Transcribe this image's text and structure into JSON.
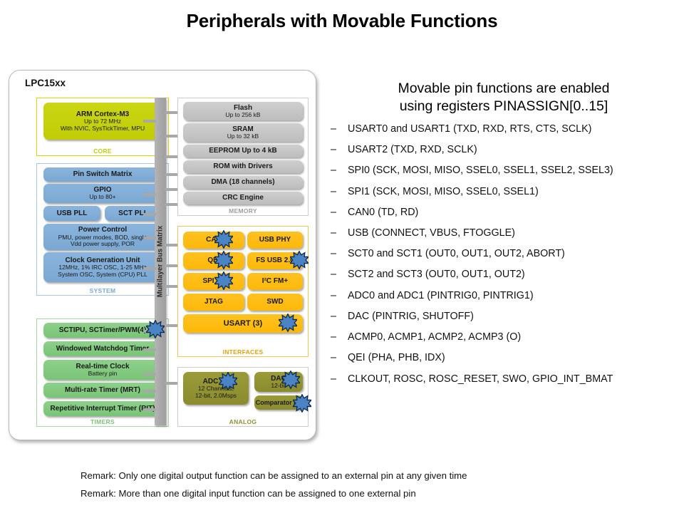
{
  "slide": {
    "title": "Peripherals with Movable Functions"
  },
  "chip": {
    "name": "LPC15xx",
    "bus_matrix_label": "Multilayer Bus Matrix",
    "groups": {
      "core": {
        "label": "CORE",
        "blocks": [
          {
            "title": "ARM Cortex-M3",
            "line2": "Up to 72 MHz",
            "line3": "With NVIC, SysTickTimer, MPU",
            "burst": false
          }
        ]
      },
      "system": {
        "label": "SYSTEM",
        "blocks": [
          {
            "title": "Pin Switch Matrix",
            "line2": "",
            "burst": false
          },
          {
            "title": "GPIO",
            "line2": "Up to 80+",
            "burst": false
          },
          {
            "title": "USB PLL",
            "line2": "",
            "burst": false
          },
          {
            "title": "SCT PLL",
            "line2": "",
            "burst": false
          },
          {
            "title": "Power Control",
            "line2": "PMU, power modes, BOD, single",
            "line3": "Vdd power supply, POR",
            "burst": false
          },
          {
            "title": "Clock Generation  Unit",
            "line2": "12MHz, 1% IRC OSC, 1-25 MHz",
            "line3": "System OSC, System (CPU) PLL",
            "burst": false
          }
        ]
      },
      "timers": {
        "label": "TIMERS",
        "blocks": [
          {
            "title": "SCTIPU, SCTimer/PWM(4)",
            "line2": "",
            "burst": true
          },
          {
            "title": "Windowed  Watchdog Timer",
            "line2": "",
            "burst": false
          },
          {
            "title": "Real-time Clock",
            "line2": "Battery pin",
            "burst": false
          },
          {
            "title": "Multi-rate Timer (MRT)",
            "line2": "",
            "burst": false
          },
          {
            "title": "Repetitive Interrupt  Timer (RIT)",
            "line2": "",
            "burst": false
          }
        ]
      },
      "memory": {
        "label": "MEMORY",
        "blocks": [
          {
            "title": "Flash",
            "line2": "Up to 256 kB",
            "burst": false
          },
          {
            "title": "SRAM",
            "line2": "Up to 32 kB",
            "burst": false
          },
          {
            "title": "EEPROM Up to 4 kB",
            "line2": "",
            "burst": false
          },
          {
            "title": "ROM with Drivers",
            "line2": "",
            "burst": false
          },
          {
            "title": "DMA (18 channels)",
            "line2": "",
            "burst": false
          },
          {
            "title": "CRC Engine",
            "line2": "",
            "burst": false
          }
        ]
      },
      "interfaces": {
        "label": "INTERFACES",
        "blocks": [
          {
            "title": "CAN",
            "line2": "",
            "burst": true
          },
          {
            "title": "USB PHY",
            "line2": "",
            "burst": false
          },
          {
            "title": "QEI",
            "line2": "",
            "burst": true
          },
          {
            "title": "FS USB 2.0",
            "line2": "",
            "burst": true
          },
          {
            "title": "SPI (2)",
            "line2": "",
            "burst": true
          },
          {
            "title": "I²C FM+",
            "line2": "",
            "burst": false
          },
          {
            "title": "JTAG",
            "line2": "",
            "burst": false
          },
          {
            "title": "SWD",
            "line2": "",
            "burst": false
          },
          {
            "title": "USART  (3)",
            "line2": "",
            "burst": true
          }
        ]
      },
      "analog": {
        "label": "ANALOG",
        "blocks": [
          {
            "title": "ADC (2)",
            "line2": "12 Channels,",
            "line3": "12-bit, 2.0Msps",
            "burst": true
          },
          {
            "title": "DAC",
            "line2": "12-bit",
            "burst": true
          },
          {
            "title": "Comparator (4)",
            "line2": "",
            "burst": true
          }
        ]
      }
    }
  },
  "pin_functions": {
    "heading_line1": "Movable pin functions are enabled",
    "heading_line2": "using registers PINASSIGN[0..15]",
    "items": [
      "USART0 and USART1 (TXD, RXD, RTS, CTS, SCLK)",
      "USART2 (TXD, RXD, SCLK)",
      "SPI0 (SCK, MOSI, MISO, SSEL0, SSEL1, SSEL2, SSEL3)",
      "SPI1 (SCK, MOSI, MISO, SSEL0, SSEL1)",
      "CAN0 (TD, RD)",
      "USB (CONNECT, VBUS, FTOGGLE)",
      "SCT0 and SCT1 (OUT0, OUT1, OUT2, ABORT)",
      "SCT2 and SCT3 (OUT0, OUT1, OUT2)",
      "ADC0 and ADC1 (PINTRIG0, PINTRIG1)",
      "DAC (PINTRIG, SHUTOFF)",
      "ACMP0, ACMP1, ACMP2, ACMP3 (O)",
      "QEI (PHA, PHB, IDX)",
      "CLKOUT, ROSC, ROSC_RESET, SWO, GPIO_INT_BMAT"
    ]
  },
  "remarks": [
    "Remark:  Only one digital output function can be assigned to an external pin at any given time",
    "Remark:  More than one digital input function can be assigned to one external pin"
  ],
  "colors": {
    "core": "#c6d30b",
    "system": "#7fabd6",
    "timers": "#7fc77c",
    "memory": "#c4c4c4",
    "interfaces": "#fdb913",
    "analog": "#8f9031",
    "burst": "#4a84c4",
    "bus_matrix": "#a8a8a8"
  }
}
